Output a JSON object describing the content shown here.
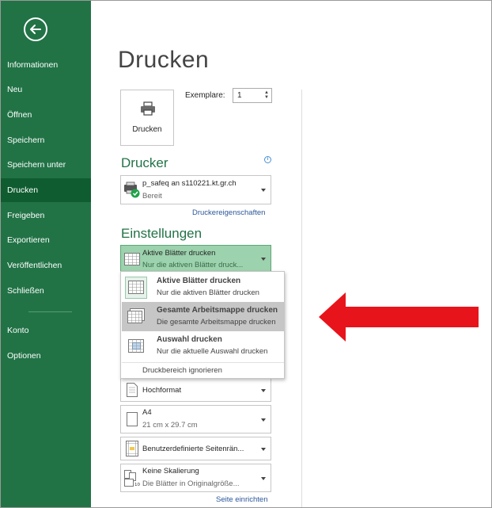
{
  "sidebar": {
    "back_icon": "back-arrow-icon",
    "items": [
      {
        "label": "Informationen"
      },
      {
        "label": "Neu"
      },
      {
        "label": "Öffnen"
      },
      {
        "label": "Speichern"
      },
      {
        "label": "Speichern unter"
      },
      {
        "label": "Drucken",
        "active": true
      },
      {
        "label": "Freigeben"
      },
      {
        "label": "Exportieren"
      },
      {
        "label": "Veröffentlichen"
      },
      {
        "label": "Schließen"
      },
      {
        "label": "Konto"
      },
      {
        "label": "Optionen"
      }
    ]
  },
  "main": {
    "title": "Drucken",
    "print_button_label": "Drucken",
    "copies_label": "Exemplare:",
    "copies_value": "1"
  },
  "printer": {
    "section_title": "Drucker",
    "name": "p_safeq an s110221.kt.gr.ch",
    "status": "Bereit",
    "properties_link": "Druckereigenschaften"
  },
  "settings": {
    "section_title": "Einstellungen",
    "selected": {
      "title": "Aktive Blätter drucken",
      "subtitle": "Nur die aktiven Blätter druck..."
    },
    "menu": [
      {
        "title": "Aktive Blätter drucken",
        "subtitle": "Nur die aktiven Blätter drucken"
      },
      {
        "title": "Gesamte Arbeitsmappe drucken",
        "subtitle": "Die gesamte Arbeitsmappe drucken"
      },
      {
        "title": "Auswahl drucken",
        "subtitle": "Nur die aktuelle Auswahl drucken"
      }
    ],
    "ignore_print_area": "Druckbereich ignorieren",
    "orientation": "Hochformat",
    "paper_size": "A4",
    "paper_dims": "21  cm x 29.7  cm",
    "margins": "Benutzerdefinierte Seitenrän...",
    "scaling": "Keine Skalierung",
    "scaling_sub": "Die Blätter in Originalgröße...",
    "page_setup_link": "Seite einrichten"
  },
  "colors": {
    "sidebar": "#217346",
    "sidebar_active": "#0e5c2f",
    "accent": "#217346",
    "link": "#2b579a",
    "arrow": "#e8141b"
  }
}
